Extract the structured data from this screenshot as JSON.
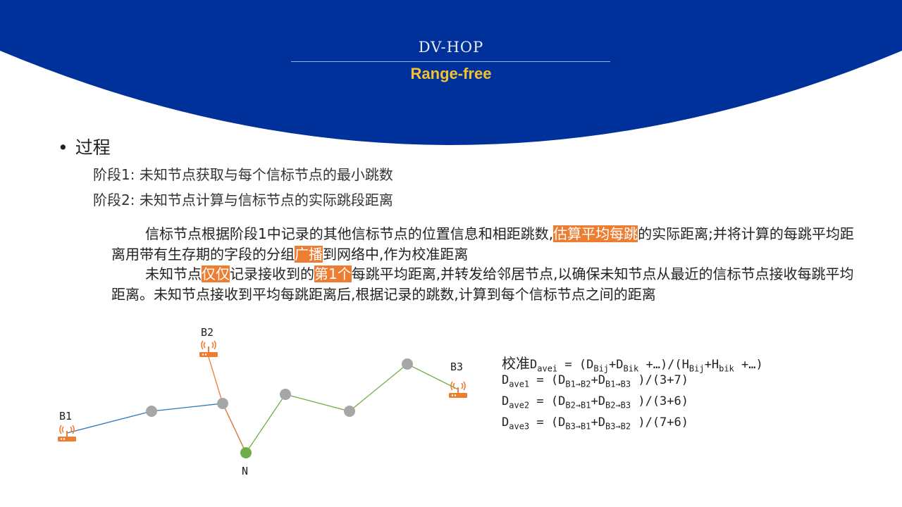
{
  "header": {
    "title": "DV-HOP",
    "subtitle": "Range-free",
    "band_color": "#00309a"
  },
  "content": {
    "heading": "过程",
    "stage1": "阶段1: 未知节点获取与每个信标节点的最小跳数",
    "stage2": "阶段2: 未知节点计算与信标节点的实际跳段距离",
    "para1": {
      "a": "信标节点根据阶段1中记录的其他信标节点的位置信息和相距跳数,",
      "hl1": "估算平均每跳",
      "b": "的实际距离;并将计算的每跳平均距离用带有生存期的字段的分组",
      "hl2": "广播",
      "c": "到网络中,作为校准距离"
    },
    "para2": {
      "a": "未知节点",
      "hl1": "仅仅",
      "b": "记录接收到的",
      "hl2": "第1个",
      "c": "每跳平均距离,并转发给邻居节点,以确保未知节点从最近的信标节点接收每跳平均距离。未知节点接收到平均每跳距离后,根据记录的跳数,计算到每个信标节点之间的距离"
    },
    "highlight_color": "#ed7d31"
  },
  "diagram": {
    "labels": {
      "b1": "B1",
      "b2": "B2",
      "b3": "B3",
      "n": "N"
    },
    "beacon_icon": "wifi-router-icon",
    "colors": {
      "beacon": "#ed7d31",
      "relay": "#a6a6a6",
      "unknown": "#70ad47",
      "path_b1": "#2e75b6",
      "path_b2": "#ed7d31",
      "path_b3": "#70ad47"
    }
  },
  "formulas": {
    "calib": {
      "prefix": "校准",
      "D": "D",
      "ave_sub": "avei",
      "eq": " = (",
      "t1": "D",
      "t1s": "Bij",
      "plus": "+",
      "t2": "D",
      "t2s": "Bik",
      "mid": " +…)/(",
      "t3": "H",
      "t3s": "Bij",
      "plus2": "+",
      "t4": "H",
      "t4s": "bik",
      "end": " +…)"
    },
    "rows": [
      {
        "D": "D",
        "sub": "ave1",
        "eq": " = (",
        "t1": "D",
        "t1s": "B1→B2",
        "plus": "+",
        "t2": "D",
        "t2s": "B1→B3",
        "end": " )/(3+7)"
      },
      {
        "D": "D",
        "sub": "ave2",
        "eq": " = (",
        "t1": "D",
        "t1s": "B2→B1",
        "plus": "+",
        "t2": "D",
        "t2s": "B2→B3",
        "end": " )/(3+6)"
      },
      {
        "D": "D",
        "sub": "ave3",
        "eq": " = (",
        "t1": "D",
        "t1s": "B3→B1",
        "plus": "+",
        "t2": "D",
        "t2s": "B3→B2",
        "end": " )/(7+6)"
      }
    ]
  }
}
